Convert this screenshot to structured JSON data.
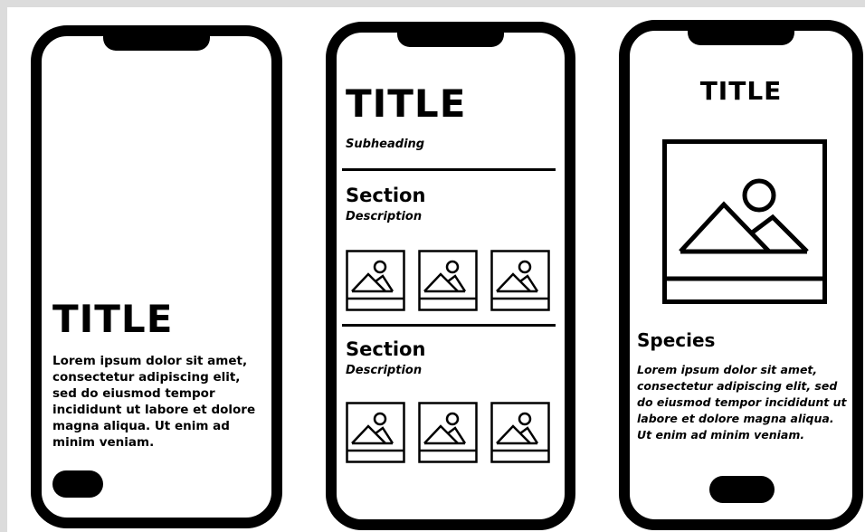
{
  "phones": [
    {
      "title": "TITLE",
      "body": "Lorem ipsum dolor sit amet, consectetur adipiscing elit, sed do eiusmod tempor incididunt ut labore et dolore magna aliqua. Ut enim ad minim veniam."
    },
    {
      "title": "TITLE",
      "subheading": "Subheading",
      "sections": [
        {
          "title": "Section",
          "description": "Description"
        },
        {
          "title": "Section",
          "description": "Description"
        }
      ]
    },
    {
      "title": "TITLE",
      "species": "Species",
      "body": "Lorem ipsum dolor sit amet, consectetur adipiscing elit, sed do eiusmod tempor incididunt ut labore et dolore magna aliqua. Ut enim ad minim veniam."
    }
  ]
}
